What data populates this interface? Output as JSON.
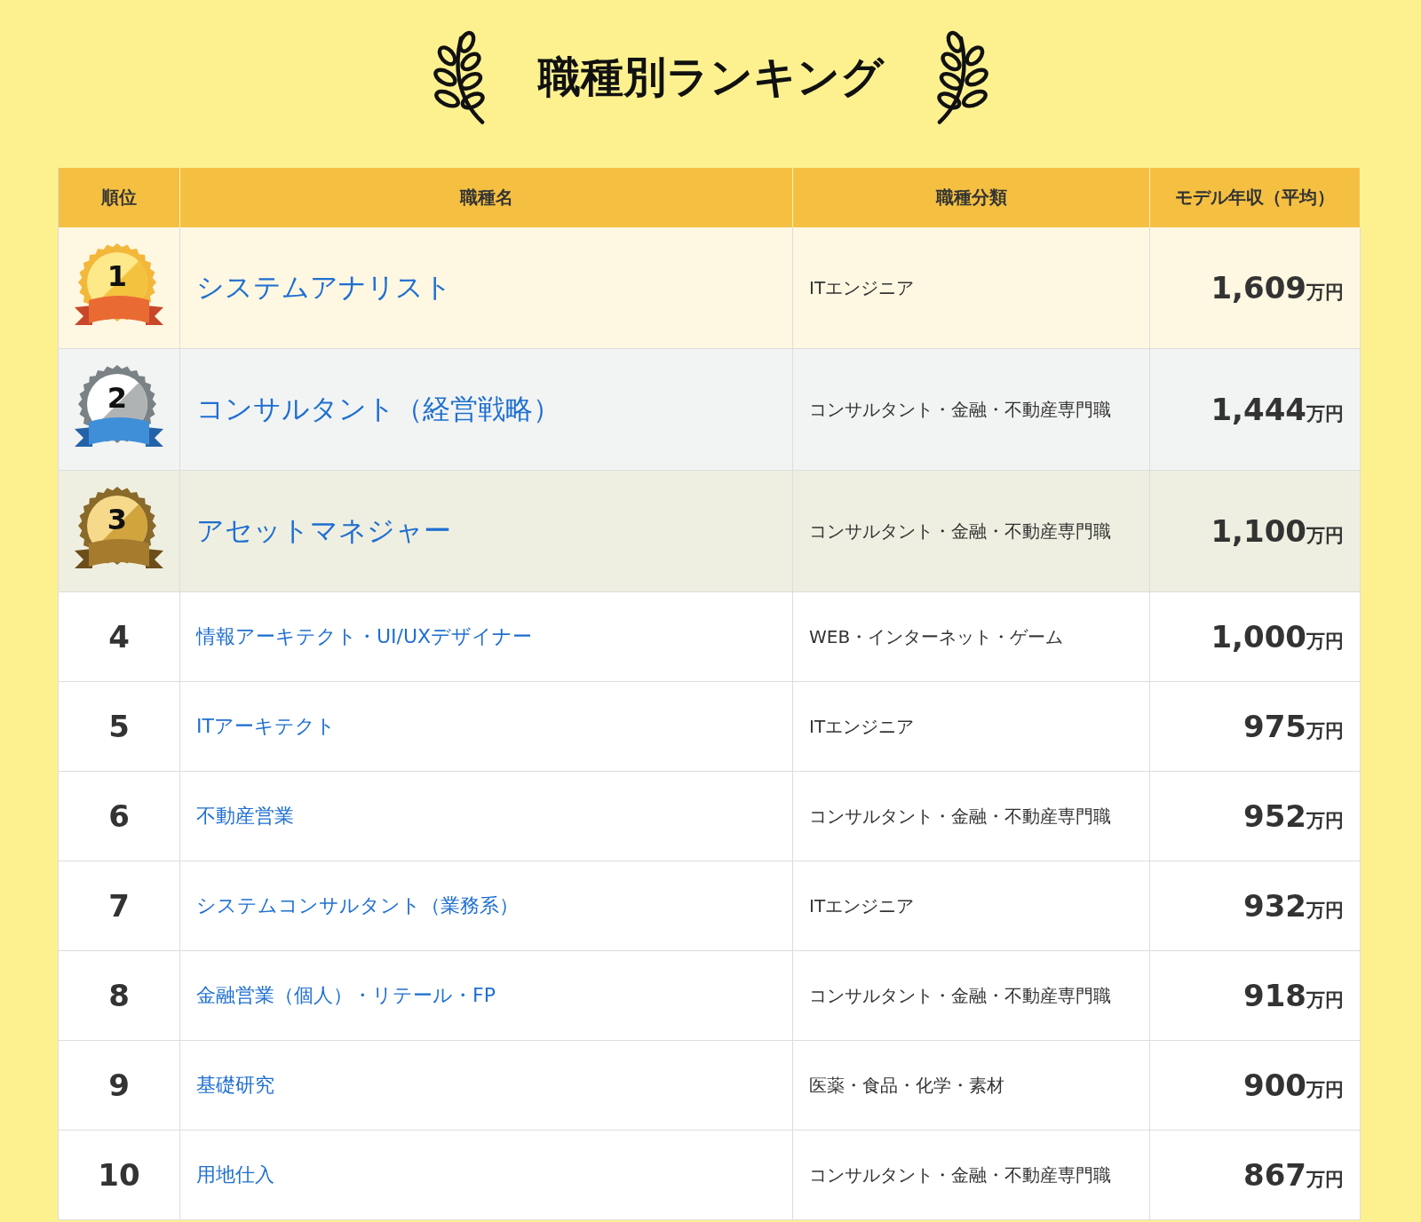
{
  "title": "職種別ランキング",
  "columns": [
    "順位",
    "職種名",
    "職種分類",
    "モデル年収（平均）"
  ],
  "rows": [
    {
      "rank": "1",
      "kind": "gold",
      "title": "システムアナリスト",
      "category": "ITエンジニア",
      "salary": "1,609",
      "unit": "万円"
    },
    {
      "rank": "2",
      "kind": "silver",
      "title": "コンサルタント（経営戦略）",
      "category": "コンサルタント・金融・不動産専門職",
      "salary": "1,444",
      "unit": "万円"
    },
    {
      "rank": "3",
      "kind": "bronze",
      "title": "アセットマネジャー",
      "category": "コンサルタント・金融・不動産専門職",
      "salary": "1,100",
      "unit": "万円"
    },
    {
      "rank": "4",
      "kind": "plain",
      "title": "情報アーキテクト・UI/UXデザイナー",
      "category": "WEB・インターネット・ゲーム",
      "salary": "1,000",
      "unit": "万円"
    },
    {
      "rank": "5",
      "kind": "plain",
      "title": "ITアーキテクト",
      "category": "ITエンジニア",
      "salary": "975",
      "unit": "万円"
    },
    {
      "rank": "6",
      "kind": "plain",
      "title": "不動産営業",
      "category": "コンサルタント・金融・不動産専門職",
      "salary": "952",
      "unit": "万円"
    },
    {
      "rank": "7",
      "kind": "plain",
      "title": "システムコンサルタント（業務系）",
      "category": "ITエンジニア",
      "salary": "932",
      "unit": "万円"
    },
    {
      "rank": "8",
      "kind": "plain",
      "title": "金融営業（個人）・リテール・FP",
      "category": "コンサルタント・金融・不動産専門職",
      "salary": "918",
      "unit": "万円"
    },
    {
      "rank": "9",
      "kind": "plain",
      "title": "基礎研究",
      "category": "医薬・食品・化学・素材",
      "salary": "900",
      "unit": "万円"
    },
    {
      "rank": "10",
      "kind": "plain",
      "title": "用地仕入",
      "category": "コンサルタント・金融・不動産専門職",
      "salary": "867",
      "unit": "万円"
    }
  ]
}
